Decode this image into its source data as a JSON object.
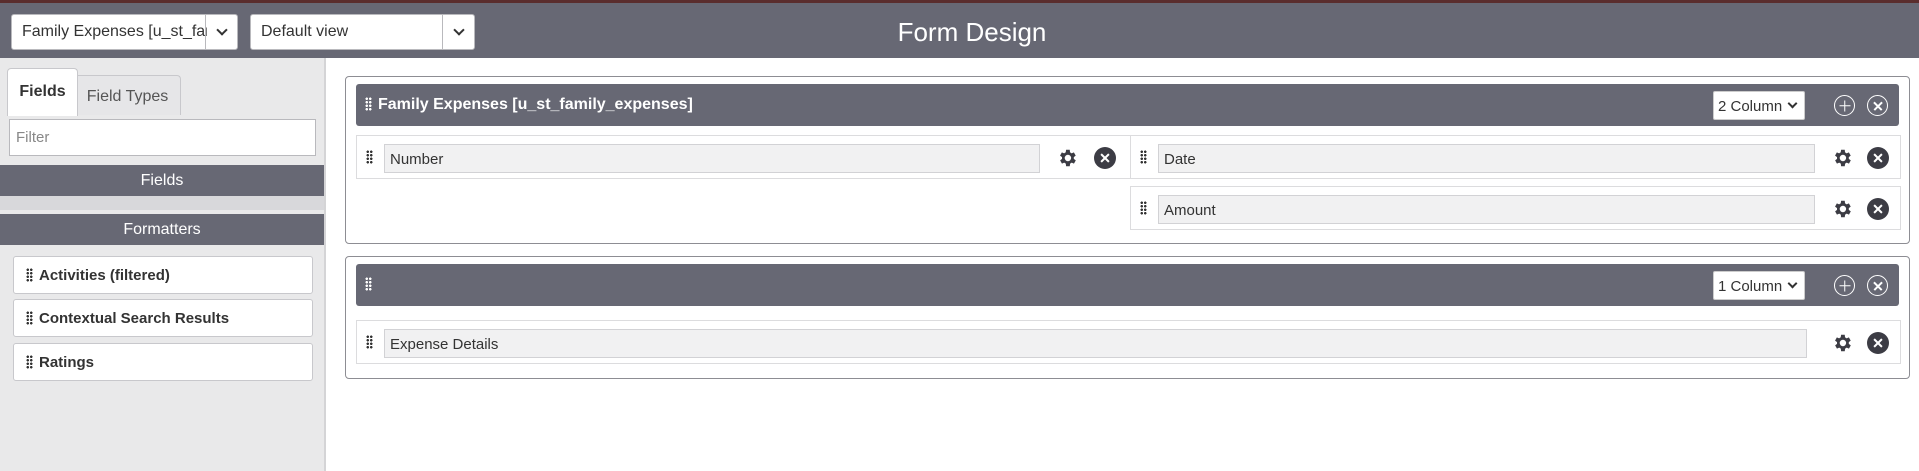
{
  "header": {
    "table_select": "Family Expenses [u_st_family_expenses]",
    "view_select": "Default view",
    "title": "Form Design"
  },
  "sidebar": {
    "tabs": [
      {
        "label": "Fields",
        "active": true
      },
      {
        "label": "Field Types",
        "active": false
      }
    ],
    "filter_placeholder": "Filter",
    "fields_section": "Fields",
    "formatters_section": "Formatters",
    "formatters": [
      {
        "label": "Activities (filtered)"
      },
      {
        "label": "Contextual Search Results"
      },
      {
        "label": "Ratings"
      }
    ]
  },
  "form": {
    "sections": [
      {
        "title": "Family Expenses [u_st_family_expenses]",
        "columns": "2 Column",
        "left_fields": [
          {
            "label": "Number"
          }
        ],
        "right_fields": [
          {
            "label": "Date"
          },
          {
            "label": "Amount"
          }
        ]
      },
      {
        "title": "",
        "columns": "1 Column",
        "fields": [
          {
            "label": "Expense Details"
          }
        ]
      }
    ]
  },
  "colors": {
    "header_bg": "#676874",
    "panel_bg": "#e9e9ea",
    "field_bg": "#f1f1f2",
    "delete_icon": "#3c3c44"
  },
  "icons": {
    "drag": "drag-handle-icon",
    "settings": "gear-icon",
    "remove": "close-circle-icon",
    "add": "plus-circle-icon",
    "dropdown": "chevron-down-icon"
  }
}
